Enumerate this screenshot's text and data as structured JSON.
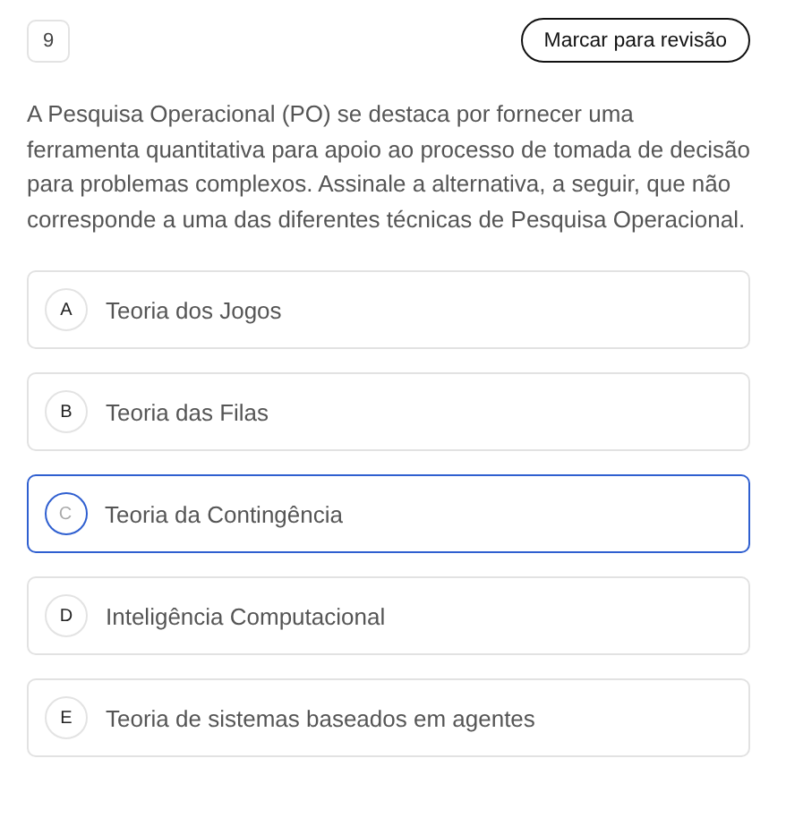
{
  "question_number": "9",
  "review_button": "Marcar para revisão",
  "statement": "A Pesquisa Operacional (PO) se destaca por fornecer uma ferramenta quantitativa para apoio ao processo de tomada de decisão para problemas complexos. Assinale a alternativa, a seguir, que não corresponde a uma das diferentes técnicas de Pesquisa Operacional.",
  "options": [
    {
      "letter": "A",
      "text": "Teoria dos Jogos",
      "selected": false
    },
    {
      "letter": "B",
      "text": "Teoria das Filas",
      "selected": false
    },
    {
      "letter": "C",
      "text": "Teoria da Contingência",
      "selected": true
    },
    {
      "letter": "D",
      "text": "Inteligência Computacional",
      "selected": false
    },
    {
      "letter": "E",
      "text": "Teoria de sistemas baseados em agentes",
      "selected": false
    }
  ]
}
